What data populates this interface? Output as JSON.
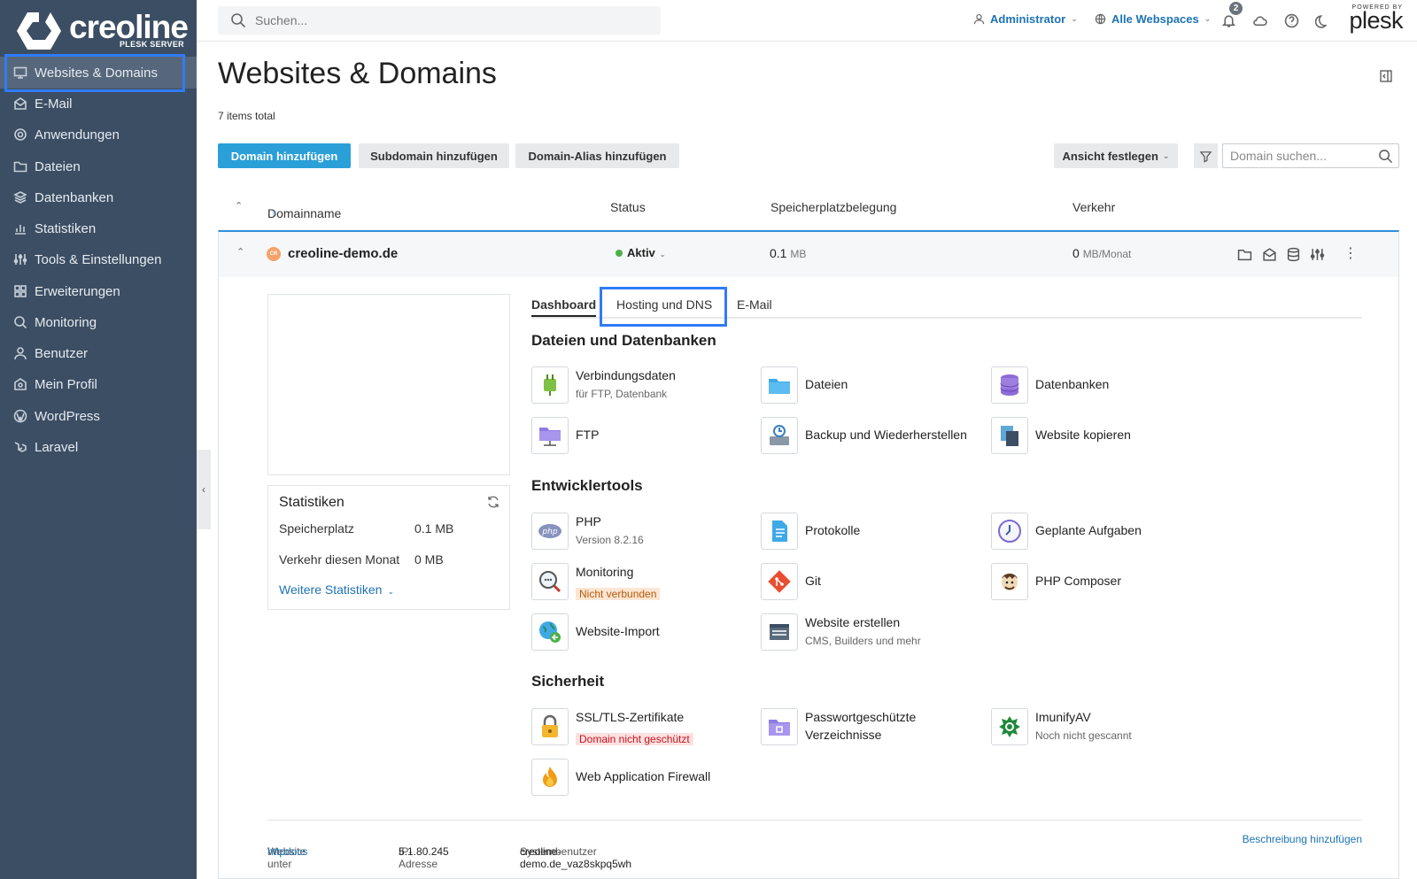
{
  "brand": {
    "name": "creoline",
    "subtitle": "PLESK SERVER"
  },
  "sidebar": {
    "items": [
      {
        "label": "Websites & Domains",
        "icon": "monitor-icon",
        "active": true
      },
      {
        "label": "E-Mail",
        "icon": "mail-icon"
      },
      {
        "label": "Anwendungen",
        "icon": "gear-icon"
      },
      {
        "label": "Dateien",
        "icon": "folder-icon"
      },
      {
        "label": "Datenbanken",
        "icon": "layers-icon"
      },
      {
        "label": "Statistiken",
        "icon": "bar-chart-icon"
      },
      {
        "label": "Tools & Einstellungen",
        "icon": "sliders-icon"
      },
      {
        "label": "Erweiterungen",
        "icon": "grid-icon"
      },
      {
        "label": "Monitoring",
        "icon": "search-icon"
      },
      {
        "label": "Benutzer",
        "icon": "user-icon"
      },
      {
        "label": "Mein Profil",
        "icon": "profile-icon"
      },
      {
        "label": "WordPress",
        "icon": "wordpress-icon"
      },
      {
        "label": "Laravel",
        "icon": "laravel-icon"
      }
    ]
  },
  "topbar": {
    "search_placeholder": "Suchen...",
    "user": "Administrator",
    "webspaces": "Alle Webspaces",
    "notifications": "2",
    "powered_by": "POWERED BY",
    "plesk": "plesk"
  },
  "page": {
    "title": "Websites & Domains",
    "items_total": "7 items total",
    "buttons": {
      "add_domain": "Domain hinzufügen",
      "add_subdomain": "Subdomain hinzufügen",
      "add_alias": "Domain-Alias hinzufügen",
      "view": "Ansicht festlegen"
    },
    "domain_search_placeholder": "Domain suchen..."
  },
  "table": {
    "headers": {
      "name": "Domainname",
      "status": "Status",
      "disk": "Speicherplatzbelegung",
      "traffic": "Verkehr"
    },
    "row": {
      "domain": "creoline-demo.de",
      "avatar": "CR",
      "status": "Aktiv",
      "disk_value": "0.1",
      "disk_unit": "MB",
      "traffic_value": "0",
      "traffic_unit": "MB/Monat"
    }
  },
  "stats": {
    "title": "Statistiken",
    "disk_label": "Speicherplatz",
    "disk_value": "0.1 MB",
    "traffic_label": "Verkehr diesen Monat",
    "traffic_value": "0 MB",
    "more": "Weitere Statistiken"
  },
  "tabs": [
    "Dashboard",
    "Hosting und DNS",
    "E-Mail"
  ],
  "sections": {
    "files": "Dateien und Datenbanken",
    "dev": "Entwicklertools",
    "security": "Sicherheit"
  },
  "tools": {
    "connection": {
      "label": "Verbindungsdaten",
      "sub": "für FTP, Datenbank"
    },
    "files": {
      "label": "Dateien"
    },
    "databases": {
      "label": "Datenbanken"
    },
    "ftp": {
      "label": "FTP"
    },
    "backup": {
      "label": "Backup und Wiederherstellen"
    },
    "copy": {
      "label": "Website kopieren"
    },
    "php": {
      "label": "PHP",
      "sub": "Version 8.2.16"
    },
    "logs": {
      "label": "Protokolle"
    },
    "cron": {
      "label": "Geplante Aufgaben"
    },
    "monitoring": {
      "label": "Monitoring",
      "badge": "Nicht verbunden"
    },
    "git": {
      "label": "Git"
    },
    "composer": {
      "label": "PHP Composer"
    },
    "import": {
      "label": "Website-Import"
    },
    "builder": {
      "label": "Website erstellen",
      "sub": "CMS, Builders und mehr"
    },
    "ssl": {
      "label": "SSL/TLS-Zertifikate",
      "badge": "Domain nicht geschützt"
    },
    "protected": {
      "label1": "Passwortgeschützte",
      "label2": "Verzeichnisse"
    },
    "imunify": {
      "label": "ImunifyAV",
      "sub": "Noch nicht gescannt"
    },
    "waf": {
      "label": "Web Application Firewall"
    }
  },
  "footer": {
    "website_under": "Website unter",
    "httpdocs": "httpdocs",
    "ip_label": "IP-Adresse",
    "ip": "5.1.80.245",
    "sysuser_label": "Systembenutzer",
    "sysuser": "creoline-demo.de_vaz8skpq5wh",
    "add_description": "Beschreibung hinzufügen"
  },
  "colors": {
    "sidebar": "#3c4e63",
    "accent": "#2b9fd8",
    "highlight": "#2f7cf6",
    "link": "#1d73b3"
  }
}
